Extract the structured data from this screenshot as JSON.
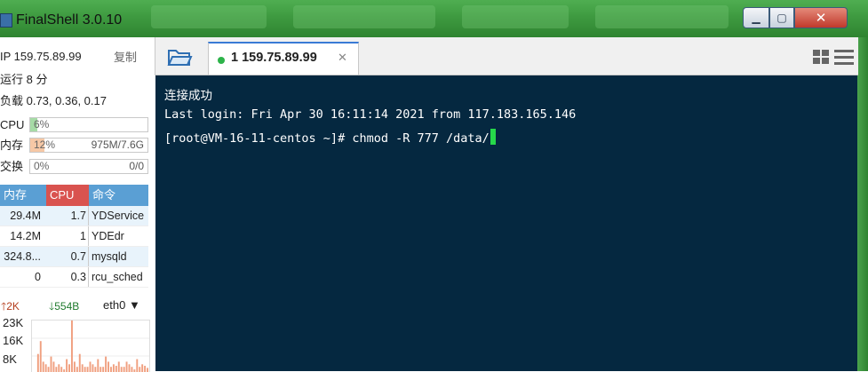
{
  "window": {
    "title": "FinalShell 3.0.10",
    "min_icon": "▁",
    "max_icon": "▢",
    "close_icon": "✕"
  },
  "sidebar": {
    "ip": "IP 159.75.89.99",
    "copy_label": "复制",
    "uptime": "运行 8 分",
    "load": "负载 0.73, 0.36, 0.17",
    "cpu": {
      "label": "CPU",
      "text": "6%",
      "percent": 6
    },
    "mem": {
      "label": "内存",
      "text": "12%",
      "detail": "975M/7.6G",
      "percent": 12
    },
    "swap": {
      "label": "交换",
      "text": "0%",
      "detail": "0/0",
      "percent": 0
    },
    "process_table": {
      "headers": [
        "内存",
        "CPU",
        "命令"
      ],
      "rows": [
        {
          "mem": "29.4M",
          "cpu": "1.7",
          "cmd": "YDService"
        },
        {
          "mem": "14.2M",
          "cpu": "1",
          "cmd": "YDEdr"
        },
        {
          "mem": "324.8...",
          "cpu": "0.7",
          "cmd": "mysqld"
        },
        {
          "mem": "0",
          "cpu": "0.3",
          "cmd": "rcu_sched"
        }
      ]
    },
    "network": {
      "up": "2K",
      "down": "554B",
      "interface": "eth0",
      "y_labels": [
        "23K",
        "16K",
        "8K"
      ],
      "bars": [
        0,
        0,
        0.35,
        0.6,
        0.2,
        0.15,
        0.1,
        0.3,
        0.2,
        0.1,
        0.15,
        0.1,
        0.05,
        0.25,
        0.15,
        1.0,
        0.2,
        0.1,
        0.35,
        0.15,
        0.1,
        0.1,
        0.2,
        0.15,
        0.1,
        0.25,
        0.1,
        0.1,
        0.3,
        0.2,
        0.1,
        0.15,
        0.12,
        0.2,
        0.1,
        0.1,
        0.2,
        0.15,
        0.1,
        0.05,
        0.25,
        0.1,
        0.15,
        0.12,
        0.08
      ]
    }
  },
  "tabs": [
    {
      "label": "1 159.75.89.99",
      "status": "connected"
    }
  ],
  "terminal": {
    "lines": [
      "连接成功",
      "Last login: Fri Apr 30 16:11:14 2021 from 117.183.165.146",
      "[root@VM-16-11-centos ~]# chmod -R 777 /data/"
    ],
    "cursor_color": "#26d84a",
    "background": "#052840"
  },
  "colors": {
    "titlebar": "#3e9a40",
    "mem_header": "#5a9fd4",
    "cpu_header": "#d9534f",
    "cmd_header": "#5a9fd4",
    "cpu_fill": "#a6dba6",
    "mem_fill": "#f6c8a6",
    "net_bar": "#f0a080"
  }
}
